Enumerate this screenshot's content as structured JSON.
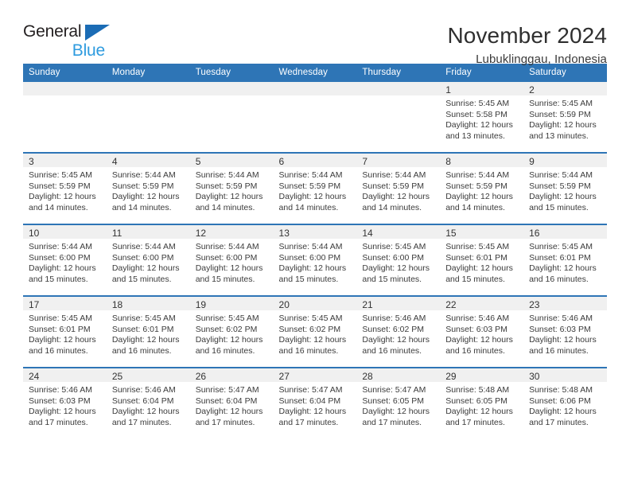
{
  "brand": {
    "name_part1": "General",
    "name_part2": "Blue",
    "triangle_icon": "triangle-icon",
    "color_dark": "#231f20",
    "color_blue": "#2e9bdf",
    "color_triangle": "#1b6cb5"
  },
  "header": {
    "title": "November 2024",
    "subtitle": "Lubuklinggau, Indonesia"
  },
  "theme": {
    "header_bg": "#2e75b6",
    "header_text": "#ffffff",
    "daynum_band_bg": "#f0f0f0",
    "row_divider": "#2e75b6"
  },
  "calendar": {
    "weekday_headers": [
      "Sunday",
      "Monday",
      "Tuesday",
      "Wednesday",
      "Thursday",
      "Friday",
      "Saturday"
    ],
    "weeks": [
      [
        {
          "day": "",
          "sunrise": "",
          "sunset": "",
          "daylight_line1": "",
          "daylight_line2": ""
        },
        {
          "day": "",
          "sunrise": "",
          "sunset": "",
          "daylight_line1": "",
          "daylight_line2": ""
        },
        {
          "day": "",
          "sunrise": "",
          "sunset": "",
          "daylight_line1": "",
          "daylight_line2": ""
        },
        {
          "day": "",
          "sunrise": "",
          "sunset": "",
          "daylight_line1": "",
          "daylight_line2": ""
        },
        {
          "day": "",
          "sunrise": "",
          "sunset": "",
          "daylight_line1": "",
          "daylight_line2": ""
        },
        {
          "day": "1",
          "sunrise": "Sunrise: 5:45 AM",
          "sunset": "Sunset: 5:58 PM",
          "daylight_line1": "Daylight: 12 hours",
          "daylight_line2": "and 13 minutes."
        },
        {
          "day": "2",
          "sunrise": "Sunrise: 5:45 AM",
          "sunset": "Sunset: 5:59 PM",
          "daylight_line1": "Daylight: 12 hours",
          "daylight_line2": "and 13 minutes."
        }
      ],
      [
        {
          "day": "3",
          "sunrise": "Sunrise: 5:45 AM",
          "sunset": "Sunset: 5:59 PM",
          "daylight_line1": "Daylight: 12 hours",
          "daylight_line2": "and 14 minutes."
        },
        {
          "day": "4",
          "sunrise": "Sunrise: 5:44 AM",
          "sunset": "Sunset: 5:59 PM",
          "daylight_line1": "Daylight: 12 hours",
          "daylight_line2": "and 14 minutes."
        },
        {
          "day": "5",
          "sunrise": "Sunrise: 5:44 AM",
          "sunset": "Sunset: 5:59 PM",
          "daylight_line1": "Daylight: 12 hours",
          "daylight_line2": "and 14 minutes."
        },
        {
          "day": "6",
          "sunrise": "Sunrise: 5:44 AM",
          "sunset": "Sunset: 5:59 PM",
          "daylight_line1": "Daylight: 12 hours",
          "daylight_line2": "and 14 minutes."
        },
        {
          "day": "7",
          "sunrise": "Sunrise: 5:44 AM",
          "sunset": "Sunset: 5:59 PM",
          "daylight_line1": "Daylight: 12 hours",
          "daylight_line2": "and 14 minutes."
        },
        {
          "day": "8",
          "sunrise": "Sunrise: 5:44 AM",
          "sunset": "Sunset: 5:59 PM",
          "daylight_line1": "Daylight: 12 hours",
          "daylight_line2": "and 14 minutes."
        },
        {
          "day": "9",
          "sunrise": "Sunrise: 5:44 AM",
          "sunset": "Sunset: 5:59 PM",
          "daylight_line1": "Daylight: 12 hours",
          "daylight_line2": "and 15 minutes."
        }
      ],
      [
        {
          "day": "10",
          "sunrise": "Sunrise: 5:44 AM",
          "sunset": "Sunset: 6:00 PM",
          "daylight_line1": "Daylight: 12 hours",
          "daylight_line2": "and 15 minutes."
        },
        {
          "day": "11",
          "sunrise": "Sunrise: 5:44 AM",
          "sunset": "Sunset: 6:00 PM",
          "daylight_line1": "Daylight: 12 hours",
          "daylight_line2": "and 15 minutes."
        },
        {
          "day": "12",
          "sunrise": "Sunrise: 5:44 AM",
          "sunset": "Sunset: 6:00 PM",
          "daylight_line1": "Daylight: 12 hours",
          "daylight_line2": "and 15 minutes."
        },
        {
          "day": "13",
          "sunrise": "Sunrise: 5:44 AM",
          "sunset": "Sunset: 6:00 PM",
          "daylight_line1": "Daylight: 12 hours",
          "daylight_line2": "and 15 minutes."
        },
        {
          "day": "14",
          "sunrise": "Sunrise: 5:45 AM",
          "sunset": "Sunset: 6:00 PM",
          "daylight_line1": "Daylight: 12 hours",
          "daylight_line2": "and 15 minutes."
        },
        {
          "day": "15",
          "sunrise": "Sunrise: 5:45 AM",
          "sunset": "Sunset: 6:01 PM",
          "daylight_line1": "Daylight: 12 hours",
          "daylight_line2": "and 15 minutes."
        },
        {
          "day": "16",
          "sunrise": "Sunrise: 5:45 AM",
          "sunset": "Sunset: 6:01 PM",
          "daylight_line1": "Daylight: 12 hours",
          "daylight_line2": "and 16 minutes."
        }
      ],
      [
        {
          "day": "17",
          "sunrise": "Sunrise: 5:45 AM",
          "sunset": "Sunset: 6:01 PM",
          "daylight_line1": "Daylight: 12 hours",
          "daylight_line2": "and 16 minutes."
        },
        {
          "day": "18",
          "sunrise": "Sunrise: 5:45 AM",
          "sunset": "Sunset: 6:01 PM",
          "daylight_line1": "Daylight: 12 hours",
          "daylight_line2": "and 16 minutes."
        },
        {
          "day": "19",
          "sunrise": "Sunrise: 5:45 AM",
          "sunset": "Sunset: 6:02 PM",
          "daylight_line1": "Daylight: 12 hours",
          "daylight_line2": "and 16 minutes."
        },
        {
          "day": "20",
          "sunrise": "Sunrise: 5:45 AM",
          "sunset": "Sunset: 6:02 PM",
          "daylight_line1": "Daylight: 12 hours",
          "daylight_line2": "and 16 minutes."
        },
        {
          "day": "21",
          "sunrise": "Sunrise: 5:46 AM",
          "sunset": "Sunset: 6:02 PM",
          "daylight_line1": "Daylight: 12 hours",
          "daylight_line2": "and 16 minutes."
        },
        {
          "day": "22",
          "sunrise": "Sunrise: 5:46 AM",
          "sunset": "Sunset: 6:03 PM",
          "daylight_line1": "Daylight: 12 hours",
          "daylight_line2": "and 16 minutes."
        },
        {
          "day": "23",
          "sunrise": "Sunrise: 5:46 AM",
          "sunset": "Sunset: 6:03 PM",
          "daylight_line1": "Daylight: 12 hours",
          "daylight_line2": "and 16 minutes."
        }
      ],
      [
        {
          "day": "24",
          "sunrise": "Sunrise: 5:46 AM",
          "sunset": "Sunset: 6:03 PM",
          "daylight_line1": "Daylight: 12 hours",
          "daylight_line2": "and 17 minutes."
        },
        {
          "day": "25",
          "sunrise": "Sunrise: 5:46 AM",
          "sunset": "Sunset: 6:04 PM",
          "daylight_line1": "Daylight: 12 hours",
          "daylight_line2": "and 17 minutes."
        },
        {
          "day": "26",
          "sunrise": "Sunrise: 5:47 AM",
          "sunset": "Sunset: 6:04 PM",
          "daylight_line1": "Daylight: 12 hours",
          "daylight_line2": "and 17 minutes."
        },
        {
          "day": "27",
          "sunrise": "Sunrise: 5:47 AM",
          "sunset": "Sunset: 6:04 PM",
          "daylight_line1": "Daylight: 12 hours",
          "daylight_line2": "and 17 minutes."
        },
        {
          "day": "28",
          "sunrise": "Sunrise: 5:47 AM",
          "sunset": "Sunset: 6:05 PM",
          "daylight_line1": "Daylight: 12 hours",
          "daylight_line2": "and 17 minutes."
        },
        {
          "day": "29",
          "sunrise": "Sunrise: 5:48 AM",
          "sunset": "Sunset: 6:05 PM",
          "daylight_line1": "Daylight: 12 hours",
          "daylight_line2": "and 17 minutes."
        },
        {
          "day": "30",
          "sunrise": "Sunrise: 5:48 AM",
          "sunset": "Sunset: 6:06 PM",
          "daylight_line1": "Daylight: 12 hours",
          "daylight_line2": "and 17 minutes."
        }
      ]
    ]
  }
}
